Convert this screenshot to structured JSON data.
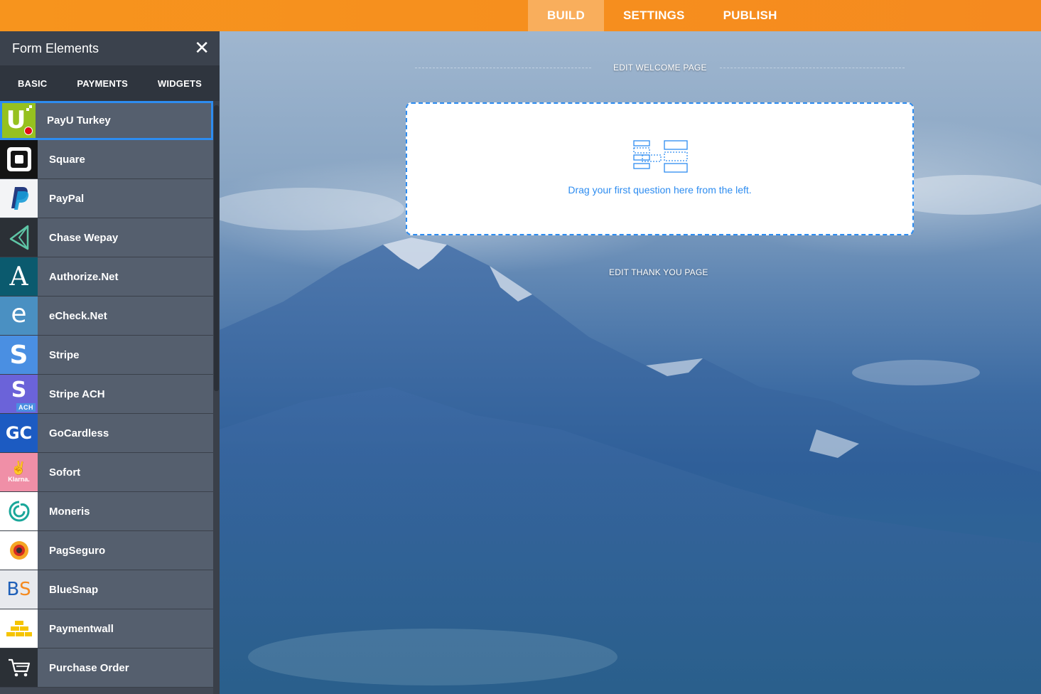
{
  "topbar": {
    "tabs": [
      {
        "label": "BUILD",
        "active": true
      },
      {
        "label": "SETTINGS",
        "active": false
      },
      {
        "label": "PUBLISH",
        "active": false
      }
    ],
    "accent_color": "#f7941d"
  },
  "sidebar": {
    "title": "Form Elements",
    "tabs": [
      {
        "label": "BASIC"
      },
      {
        "label": "PAYMENTS"
      },
      {
        "label": "WIDGETS"
      }
    ],
    "items": [
      {
        "label": "PayU Turkey",
        "icon": "payu-turkey-icon"
      },
      {
        "label": "Square",
        "icon": "square-icon"
      },
      {
        "label": "PayPal",
        "icon": "paypal-icon"
      },
      {
        "label": "Chase Wepay",
        "icon": "chase-wepay-icon"
      },
      {
        "label": "Authorize.Net",
        "icon": "authorize-net-icon"
      },
      {
        "label": "eCheck.Net",
        "icon": "echeck-net-icon"
      },
      {
        "label": "Stripe",
        "icon": "stripe-icon"
      },
      {
        "label": "Stripe ACH",
        "icon": "stripe-ach-icon"
      },
      {
        "label": "GoCardless",
        "icon": "gocardless-icon"
      },
      {
        "label": "Sofort",
        "icon": "sofort-klarna-icon"
      },
      {
        "label": "Moneris",
        "icon": "moneris-icon"
      },
      {
        "label": "PagSeguro",
        "icon": "pagseguro-icon"
      },
      {
        "label": "BlueSnap",
        "icon": "bluesnap-icon"
      },
      {
        "label": "Paymentwall",
        "icon": "paymentwall-icon"
      },
      {
        "label": "Purchase Order",
        "icon": "cart-icon"
      }
    ],
    "logo_text": {
      "payu": "U",
      "authorize": "A",
      "echeck": "e",
      "stripe": "S",
      "stripe_ach_badge": "ACH",
      "gocardless": "GC",
      "klarna": "Klarna.",
      "bluesnap_b": "B",
      "bluesnap_s": "S"
    }
  },
  "canvas": {
    "welcome_link": "EDIT WELCOME PAGE",
    "thankyou_link": "EDIT THANK YOU PAGE",
    "dropzone_text": "Drag your first question here from the left."
  }
}
